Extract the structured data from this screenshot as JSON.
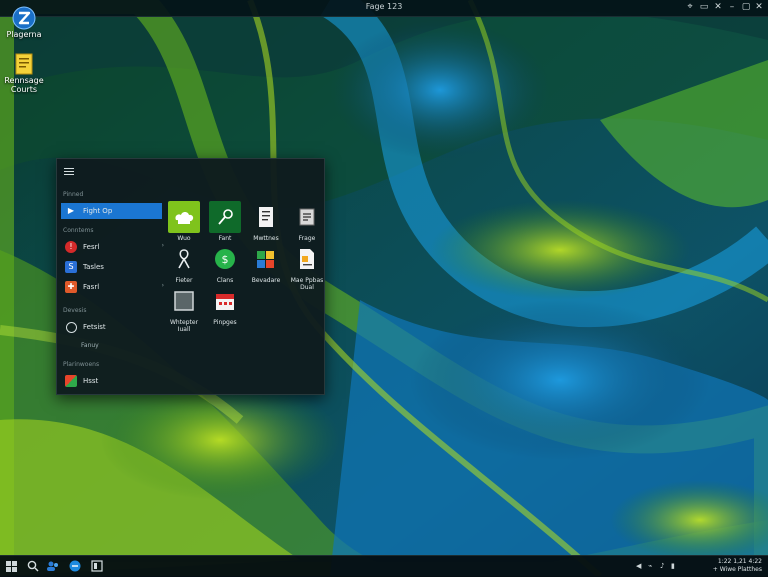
{
  "window": {
    "title": "Fage 123"
  },
  "desktop": {
    "icons": [
      {
        "label": "Plagerna",
        "icon": "z-app-icon"
      },
      {
        "label": "Rennsage\nCourts",
        "icon": "notes-file-icon"
      }
    ]
  },
  "start_menu": {
    "sections": {
      "pinned": "Pinned",
      "recent": "Conntems",
      "devices": "Devesis",
      "documents": "Plarinwoens"
    },
    "left_items": [
      {
        "label": "Fight Op",
        "active": true
      },
      {
        "label": "Fesrl"
      },
      {
        "label": "Tasles"
      },
      {
        "label": "Fasrl"
      },
      {
        "label": "Fetsist"
      },
      {
        "label": "Hsst"
      }
    ],
    "sub_text": "Fanuy",
    "tiles": [
      {
        "label": "Wuo",
        "icon": "store-icon"
      },
      {
        "label": "Fant",
        "icon": "pen-icon"
      },
      {
        "label": "Mwttnes",
        "icon": "document-icon"
      },
      {
        "label": "Frage",
        "icon": "notepad-icon"
      },
      {
        "label": "Fieter",
        "icon": "ribbon-icon"
      },
      {
        "label": "Clans",
        "icon": "spotify-icon"
      },
      {
        "label": "Bevadare",
        "icon": "folders-icon"
      },
      {
        "label": "Mae Ppbas\nDual",
        "icon": "file-icon"
      },
      {
        "label": "Whtepter\nIuall",
        "icon": "frame-icon"
      },
      {
        "label": "Pinpges",
        "icon": "calendar-icon"
      }
    ]
  },
  "taskbar": {
    "clock_time": "1:22 1,21 4:22",
    "clock_date": "+ Wiwe Platthes"
  },
  "colors": {
    "accent": "#1b76d2",
    "tile_green": "#7fc31c",
    "tile_dark": "#1a2a2d"
  }
}
